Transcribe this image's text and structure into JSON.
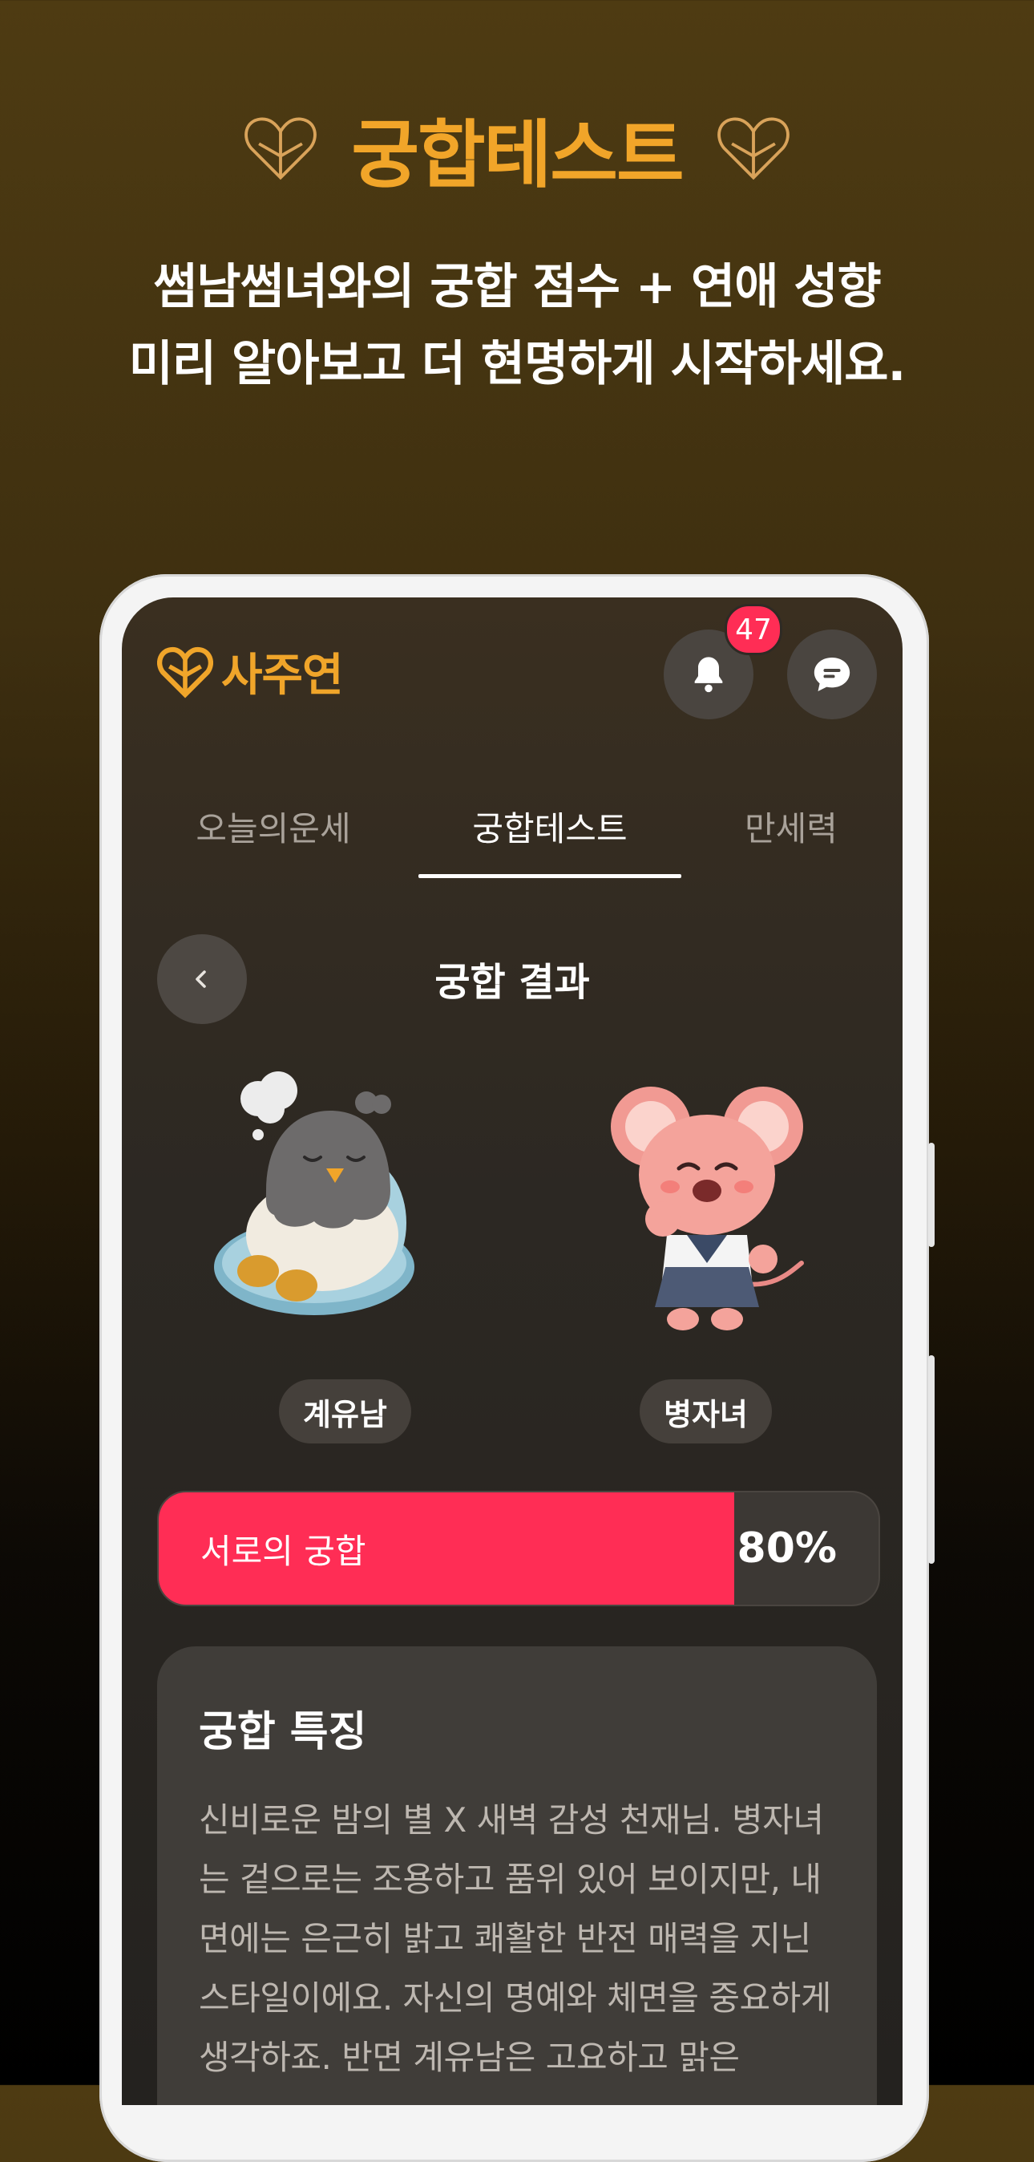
{
  "promo": {
    "title": "궁합테스트",
    "subtitle_line1": "썸남썸녀와의 궁합 점수 + 연애 성향",
    "subtitle_line2": "미리 알아보고 더 현명하게 시작하세요."
  },
  "app": {
    "brand": "사주연",
    "notification_count": "47",
    "tabs": [
      {
        "label": "오늘의운세",
        "active": false
      },
      {
        "label": "궁합테스트",
        "active": true
      },
      {
        "label": "만세력",
        "active": false
      }
    ],
    "result_title": "궁합 결과",
    "person_left": {
      "name": "계유남",
      "character": "sleeping-rooster"
    },
    "person_right": {
      "name": "병자녀",
      "character": "pink-mouse"
    },
    "score": {
      "label": "서로의 궁합",
      "value_text": "80%",
      "percent": 80
    },
    "features": {
      "title": "궁합 특징",
      "body": "신비로운 밤의 별 X 새벽 감성 천재님. 병자녀는 겉으로는 조용하고 품위 있어 보이지만, 내면에는 은근히 밝고 쾌활한 반전 매력을 지닌 스타일이에요. 자신의 명예와 체면을 중요하게 생각하죠. 반면 계유남은 고요하고 맑은"
    }
  },
  "colors": {
    "accent_gold": "#f1a529",
    "accent_pink": "#ff2d55"
  }
}
